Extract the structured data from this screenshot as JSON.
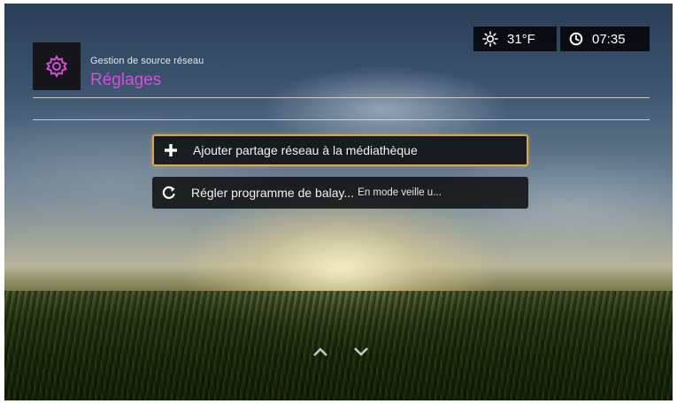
{
  "header": {
    "subtitle": "Gestion de source réseau",
    "title": "Réglages",
    "icon": "gear-icon",
    "accent_color": "#d24fd8"
  },
  "status": {
    "weather_icon": "sun-icon",
    "temperature": "31°F",
    "clock_icon": "clock-icon",
    "time": "07:35"
  },
  "menu": {
    "items": [
      {
        "icon": "plus-icon",
        "label": "Ajouter partage réseau à la médiathèque",
        "value": "",
        "selected": true
      },
      {
        "icon": "refresh-icon",
        "label": "Régler programme de balay...",
        "value": "En mode veille u...",
        "selected": false
      }
    ],
    "highlight_color": "#d8a64c"
  },
  "navigation": {
    "up_icon": "chevron-up-icon",
    "down_icon": "chevron-down-icon"
  }
}
